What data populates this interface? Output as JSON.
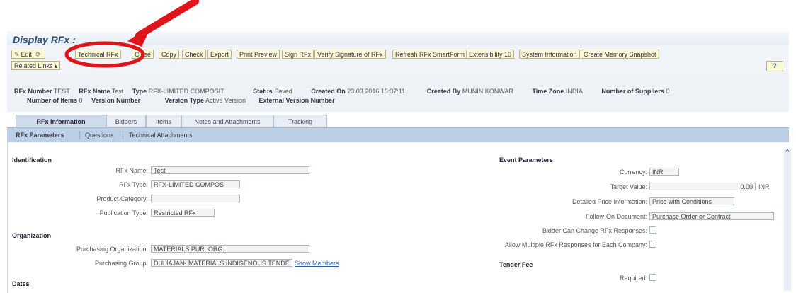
{
  "title": "Display RFx :",
  "toolbar": {
    "buttons": [
      {
        "label": "Edit",
        "icon": "pencil-icon"
      },
      {
        "label": "",
        "icon": "refresh-icon"
      },
      {
        "label": "Technical RFx"
      },
      {
        "label": "Close"
      },
      {
        "label": "Copy"
      },
      {
        "label": "Check"
      },
      {
        "label": "Export"
      },
      {
        "label": "Print Preview"
      },
      {
        "label": "Sign RFx"
      },
      {
        "label": "Verify Signature of RFx"
      },
      {
        "label": "Refresh RFx SmartForm"
      },
      {
        "label": "Extensibility 10"
      },
      {
        "label": "System Information"
      },
      {
        "label": "Create Memory Snapshot"
      }
    ],
    "related_links": "Related Links",
    "help": "?"
  },
  "header": {
    "rfx_number_label": "RFx Number",
    "rfx_number": "TEST",
    "rfx_name_label": "RFx Name",
    "rfx_name": "Test",
    "type_label": "Type",
    "type": "RFX-LIMITED COMPOSIT",
    "status_label": "Status",
    "status": "Saved",
    "created_on_label": "Created On",
    "created_on": "23.03.2016 15:37:11",
    "created_by_label": "Created By",
    "created_by": "MUNIN KONWAR",
    "time_zone_label": "Time Zone",
    "time_zone": "INDIA",
    "num_suppliers_label": "Number of Suppliers",
    "num_suppliers": "0",
    "num_items_label": "Number of Items",
    "num_items": "0",
    "version_number_label": "Version Number",
    "version_number": "",
    "version_type_label": "Version Type",
    "version_type": "Active Version",
    "ext_version_label": "External Version Number",
    "ext_version": ""
  },
  "tabs": [
    "RFx Information",
    "Bidders",
    "Items",
    "Notes and Attachments",
    "Tracking"
  ],
  "subtabs": [
    "RFx Parameters",
    "Questions",
    "Technical Attachments"
  ],
  "identification": {
    "title": "Identification",
    "rfx_name_label": "RFx Name:",
    "rfx_name": "Test",
    "rfx_type_label": "RFx Type:",
    "rfx_type": "RFX-LIMITED COMPOS",
    "product_category_label": "Product Category:",
    "product_category": "",
    "publication_type_label": "Publication Type:",
    "publication_type": "Restricted RFx"
  },
  "organization": {
    "title": "Organization",
    "purch_org_label": "Purchasing Organization:",
    "purch_org": "MATERIALS PUR. ORG.",
    "purch_group_label": "Purchasing Group:",
    "purch_group": "DULIAJAN- MATERIALS INDIGENOUS  TENDE",
    "show_members": "Show Members"
  },
  "dates": {
    "title": "Dates"
  },
  "event_params": {
    "title": "Event Parameters",
    "currency_label": "Currency:",
    "currency": "INR",
    "target_value_label": "Target Value:",
    "target_value": "0.00",
    "target_unit": "INR",
    "detailed_price_label": "Detailed Price Information:",
    "detailed_price": "Price with Conditions",
    "follow_on_label": "Follow-On Document:",
    "follow_on": "Purchase Order or Contract",
    "bidder_change_label": "Bidder Can Change RFx Responses:",
    "allow_multiple_label": "Allow Multiple RFx Responses for Each Company:"
  },
  "tender_fee": {
    "title": "Tender Fee",
    "required_label": "Required:"
  },
  "colors": {
    "annotation_red": "#e0141b",
    "toolbar_button": "#fbf8d5",
    "subtab_bar": "#bcd0e5"
  }
}
